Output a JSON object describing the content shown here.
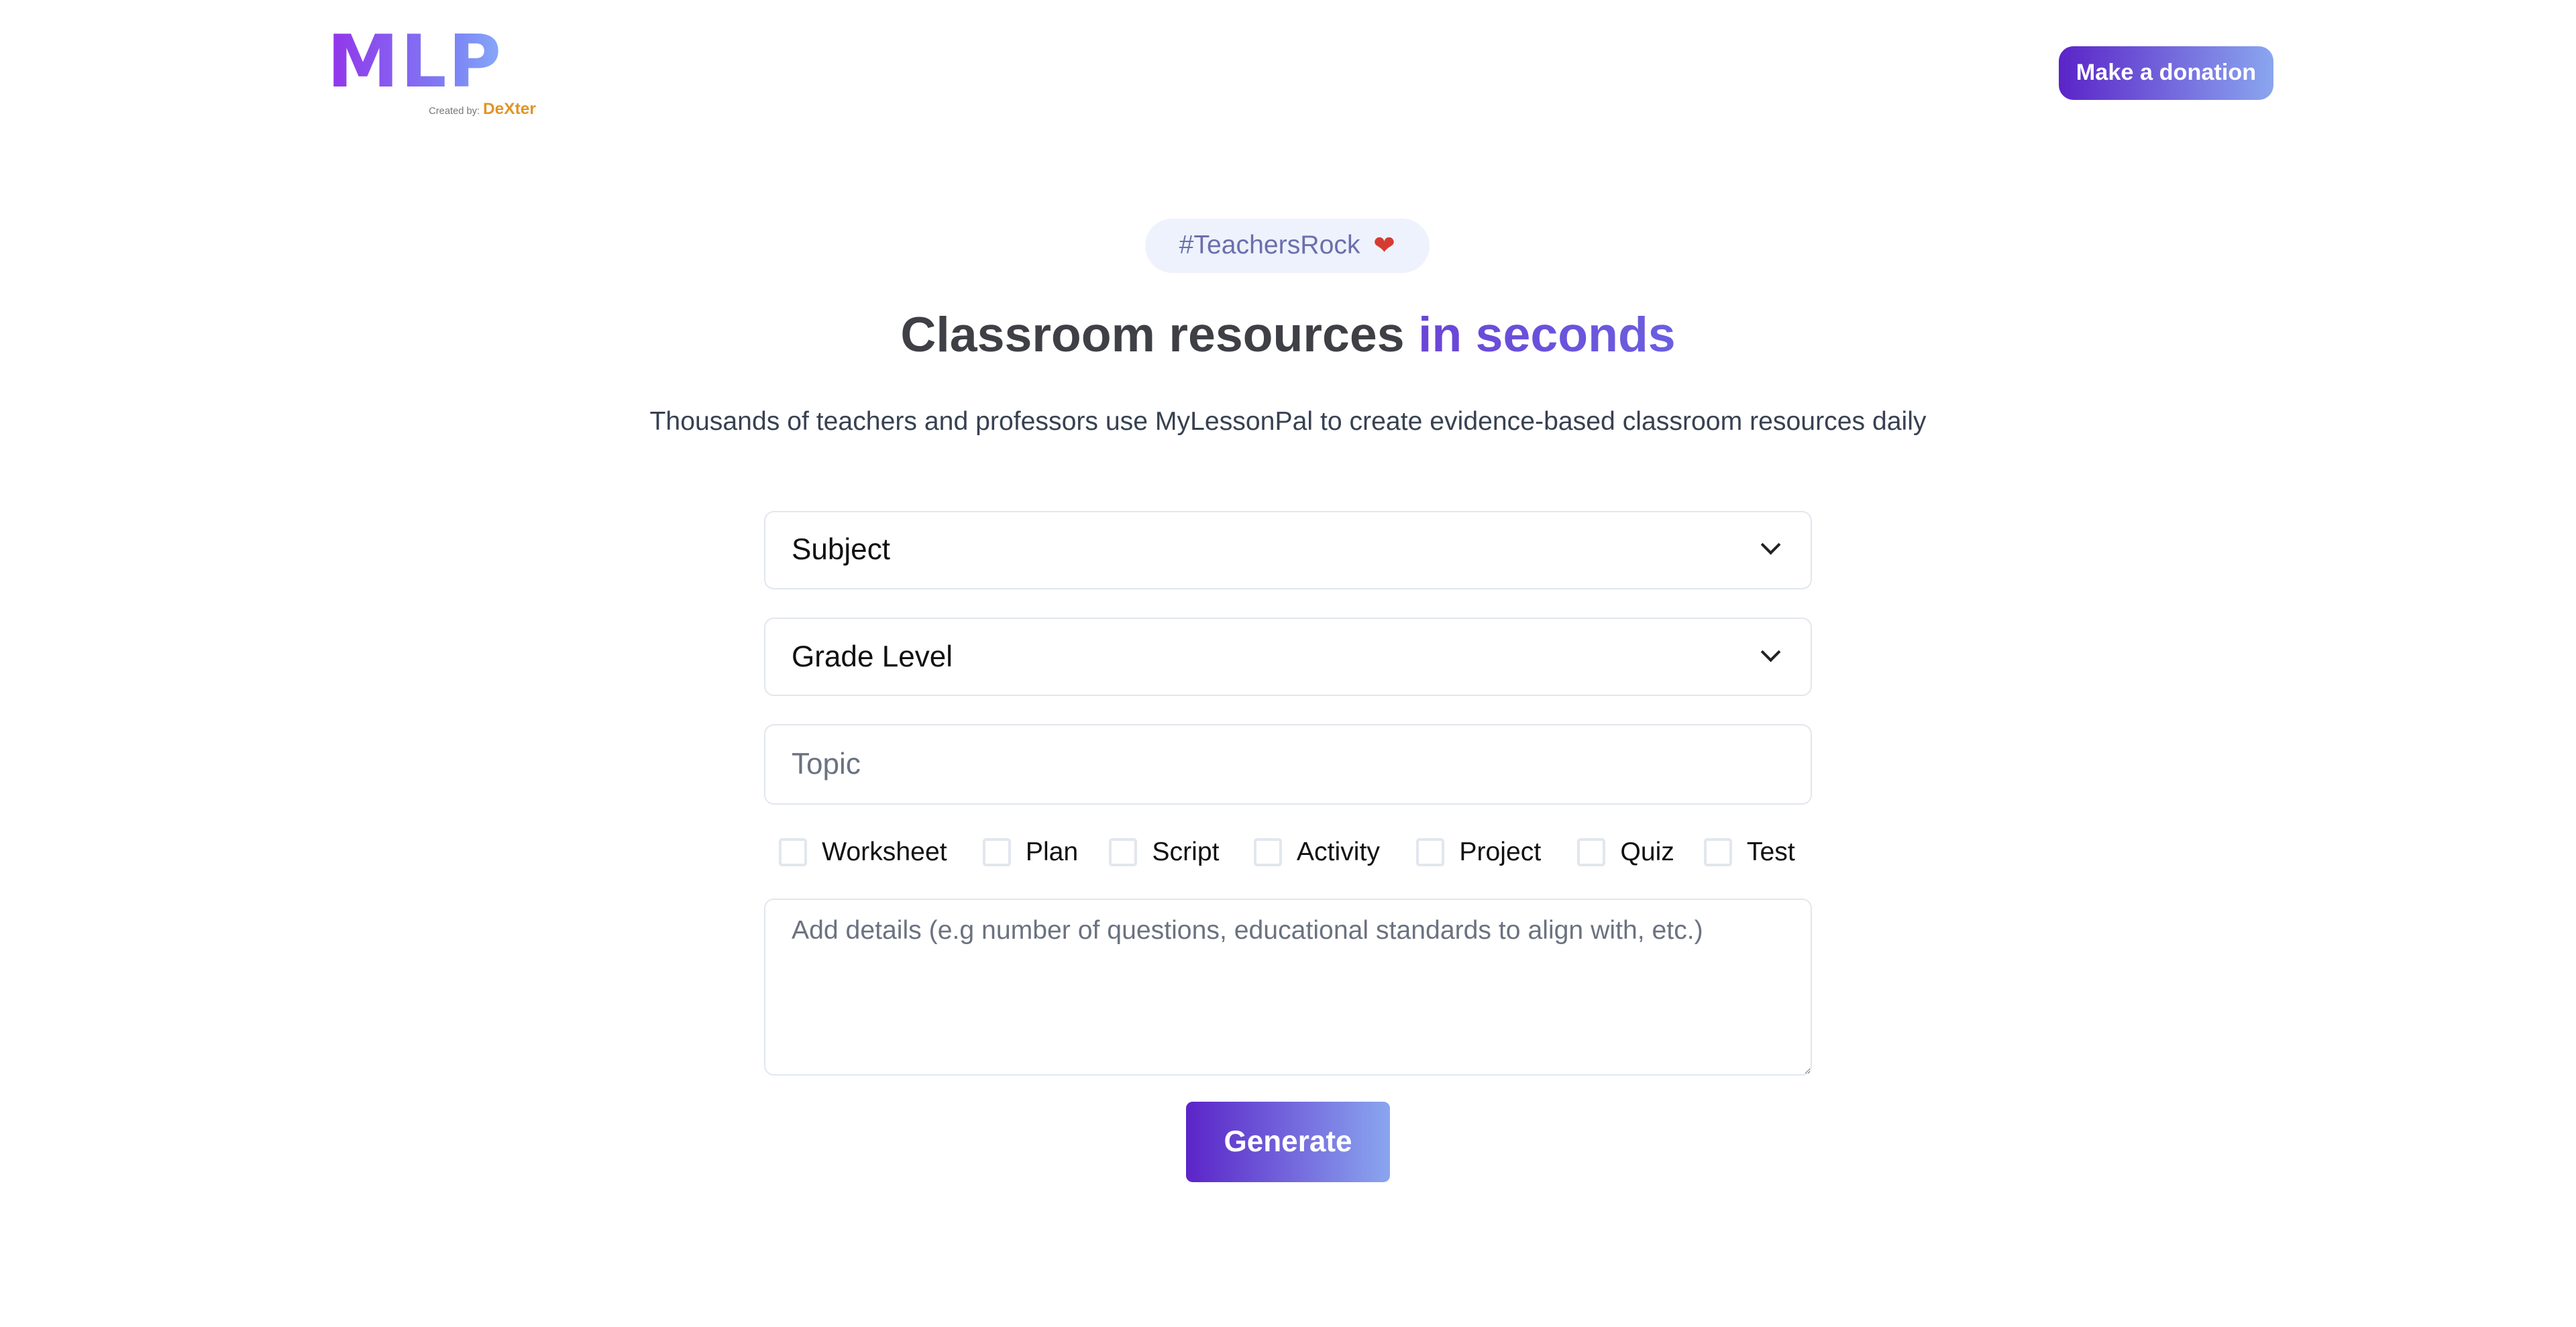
{
  "header": {
    "logo": {
      "text": "MLP",
      "created_by": "Created by:",
      "brand": "DeXter"
    },
    "donate_label": "Make a donation"
  },
  "hero": {
    "badge": "#TeachersRock",
    "badge_icon": "heart-emoji",
    "title_main": "Classroom resources ",
    "title_accent": "in seconds",
    "subtitle": "Thousands of teachers and professors use MyLessonPal to create evidence-based classroom resources daily"
  },
  "form": {
    "subject": {
      "value": "Subject"
    },
    "grade": {
      "value": "Grade Level"
    },
    "topic": {
      "placeholder": "Topic"
    },
    "types": [
      {
        "label": "Worksheet",
        "checked": false
      },
      {
        "label": "Plan",
        "checked": false
      },
      {
        "label": "Script",
        "checked": false
      },
      {
        "label": "Activity",
        "checked": false
      },
      {
        "label": "Project",
        "checked": false
      },
      {
        "label": "Quiz",
        "checked": false
      },
      {
        "label": "Test",
        "checked": false
      }
    ],
    "details": {
      "placeholder": "Add details (e.g number of questions, educational standards to align with, etc.)"
    },
    "generate_label": "Generate"
  },
  "colors": {
    "accent": "#5b24c8",
    "accent_end": "#8aa6ef",
    "badge_bg": "#eef2fc",
    "brand_orange": "#e09525"
  }
}
